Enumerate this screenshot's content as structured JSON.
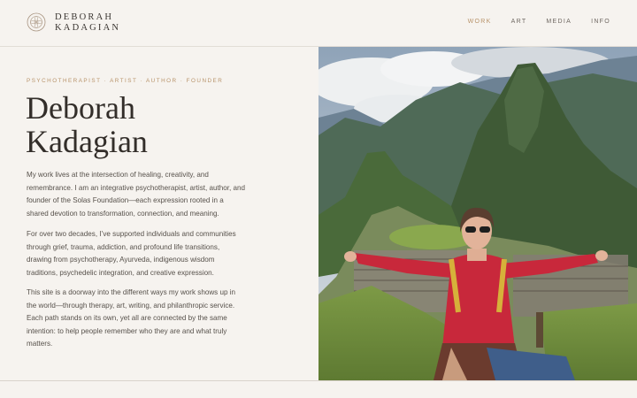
{
  "header": {
    "logo_line1": "DEBORAH",
    "logo_line2": "KADAGIAN",
    "nav": [
      {
        "label": "WORK",
        "active": true
      },
      {
        "label": "ART"
      },
      {
        "label": "MEDIA"
      },
      {
        "label": "INFO"
      }
    ]
  },
  "hero": {
    "eyebrow": "PSYCHOTHERAPIST · ARTIST · AUTHOR · FOUNDER",
    "title_line1": "Deborah",
    "title_line2": "Kadagian",
    "paragraphs": [
      "My work lives at the intersection of healing, creativity, and remembrance. I am an integrative psychotherapist, artist, author, and founder of the Solas Foundation—each expression rooted in a shared devotion to transformation, connection, and meaning.",
      "For over two decades, I’ve supported individuals and communities through grief, trauma, addiction, and profound life transitions, drawing from psychotherapy, Ayurveda, indigenous wisdom traditions, psychedelic integration, and creative expression.",
      "This site is a doorway into the different ways my work shows up in the world—through therapy, art, writing, and philanthropic service. Each path stands on its own, yet all are connected by the same intention: to help people remember who they are and what truly matters."
    ]
  },
  "colors": {
    "background": "#f6f3ef",
    "accent": "#b8936a",
    "text": "#3f3a35"
  },
  "icons": {
    "logo": "mandala-logo-icon"
  }
}
